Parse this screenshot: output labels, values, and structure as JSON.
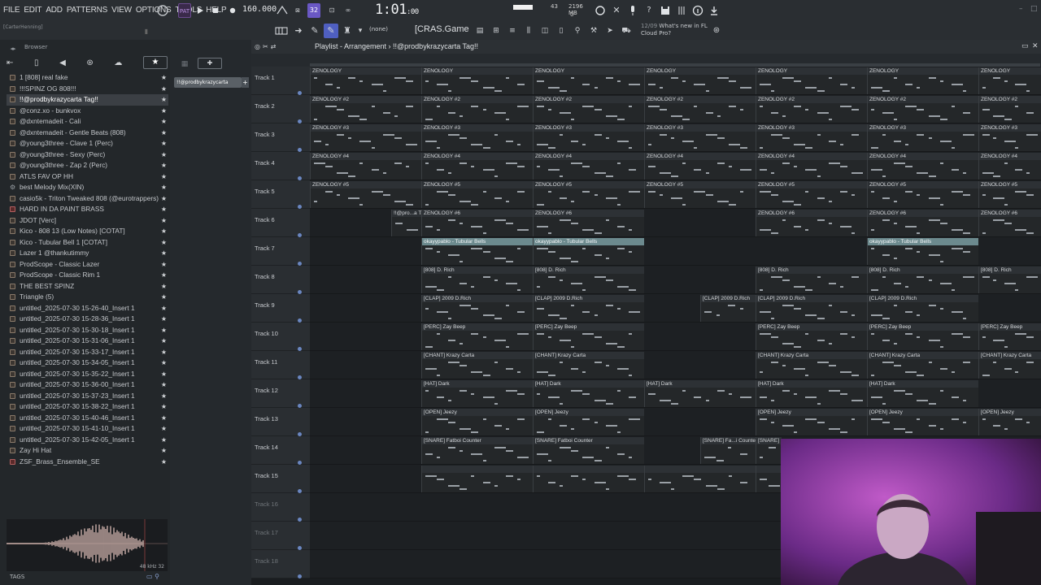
{
  "menu": [
    "FILE",
    "EDIT",
    "ADD",
    "PATTERNS",
    "VIEW",
    "OPTIONS",
    "TOOLS",
    "HELP"
  ],
  "toolbar": {
    "tempo": "160.000",
    "time_main": "1:01",
    "time_sub": ":00",
    "pattern_number": "32",
    "cpu_num": "43",
    "mem_mb": "2196 MB",
    "voices": "0",
    "pattern_select": "(none)",
    "song_name": "[CRAS.Game",
    "news_date": "12/09",
    "news_text_1": "What's new in FL",
    "news_text_2": "Cloud Pro?",
    "user": "[CarterHenning]"
  },
  "browser": {
    "title": "Browser",
    "items": [
      {
        "label": "1 [808] real fake",
        "icon": "folder"
      },
      {
        "label": "!!!SPINZ OG 808!!!",
        "icon": "folder"
      },
      {
        "label": "!!@prodbykrazycarta Tag!!",
        "icon": "folder",
        "selected": true
      },
      {
        "label": "@conz.xo - bunkvox",
        "icon": "folder"
      },
      {
        "label": "@dxntemadeit - Cali",
        "icon": "folder"
      },
      {
        "label": "@dxntemadeit - Gentle Beats (808)",
        "icon": "folder"
      },
      {
        "label": "@young3three - Clave 1 (Perc)",
        "icon": "folder"
      },
      {
        "label": "@young3three - Sexy (Perc)",
        "icon": "folder"
      },
      {
        "label": "@young3three - Zap 2 (Perc)",
        "icon": "folder"
      },
      {
        "label": "ATLS FAV OP HH",
        "icon": "folder"
      },
      {
        "label": "best Melody Mix(XIN)",
        "icon": "gear"
      },
      {
        "label": "casio5k - Triton Tweaked 808 (@eurotrappers)",
        "icon": "folder"
      },
      {
        "label": "HARD IN DA PAINT BRASS",
        "icon": "red"
      },
      {
        "label": "JDOT [Verc]",
        "icon": "folder"
      },
      {
        "label": "Kico - 808 13 (Low Notes) [COTAT]",
        "icon": "folder"
      },
      {
        "label": "Kico - Tubular Bell 1 [COTAT]",
        "icon": "folder"
      },
      {
        "label": "Lazer 1 @thankutimmy",
        "icon": "folder"
      },
      {
        "label": "ProdScope - Classic Lazer",
        "icon": "folder"
      },
      {
        "label": "ProdScope - Classic Rim 1",
        "icon": "folder"
      },
      {
        "label": "THE BEST SPINZ",
        "icon": "folder"
      },
      {
        "label": "Triangle (5)",
        "icon": "folder"
      },
      {
        "label": "untitled_2025-07-30 15-26-40_Insert 1",
        "icon": "folder"
      },
      {
        "label": "untitled_2025-07-30 15-28-36_Insert 1",
        "icon": "folder"
      },
      {
        "label": "untitled_2025-07-30 15-30-18_Insert 1",
        "icon": "folder"
      },
      {
        "label": "untitled_2025-07-30 15-31-06_Insert 1",
        "icon": "folder"
      },
      {
        "label": "untitled_2025-07-30 15-33-17_Insert 1",
        "icon": "folder"
      },
      {
        "label": "untitled_2025-07-30 15-34-05_Insert 1",
        "icon": "folder"
      },
      {
        "label": "untitled_2025-07-30 15-35-22_Insert 1",
        "icon": "folder"
      },
      {
        "label": "untitled_2025-07-30 15-36-00_Insert 1",
        "icon": "folder"
      },
      {
        "label": "untitled_2025-07-30 15-37-23_Insert 1",
        "icon": "folder"
      },
      {
        "label": "untitled_2025-07-30 15-38-22_Insert 1",
        "icon": "folder"
      },
      {
        "label": "untitled_2025-07-30 15-40-46_Insert 1",
        "icon": "folder"
      },
      {
        "label": "untitled_2025-07-30 15-41-10_Insert 1",
        "icon": "folder"
      },
      {
        "label": "untitled_2025-07-30 15-42-05_Insert 1",
        "icon": "folder"
      },
      {
        "label": "Zay Hi Hat",
        "icon": "folder"
      },
      {
        "label": "ZSF_Brass_Ensemble_SE",
        "icon": "red"
      }
    ],
    "preview_samplerate": "48 kHz 32",
    "tags_label": "TAGS"
  },
  "channel": {
    "selected_label": "!!@prodbykrazycarta"
  },
  "playlist": {
    "title": "Playlist - Arrangement  ›  !!@prodbykrazycarta Tag!!",
    "tracks": [
      {
        "name": "Track 1",
        "clips": [
          {
            "s": 0,
            "w": 137,
            "l": "ZENOLOGY"
          },
          {
            "s": 137,
            "w": 137,
            "l": "ZENOLOGY"
          },
          {
            "s": 274,
            "w": 137,
            "l": "ZENOLOGY"
          },
          {
            "s": 411,
            "w": 137,
            "l": "ZENOLOGY"
          },
          {
            "s": 548,
            "w": 137,
            "l": "ZENOLOGY"
          },
          {
            "s": 685,
            "w": 137,
            "l": "ZENOLOGY"
          },
          {
            "s": 822,
            "w": 77,
            "l": "ZENOLOGY"
          }
        ]
      },
      {
        "name": "Track 2",
        "clips": [
          {
            "s": 0,
            "w": 137,
            "l": "ZENOLOGY #2"
          },
          {
            "s": 137,
            "w": 137,
            "l": "ZENOLOGY #2"
          },
          {
            "s": 274,
            "w": 137,
            "l": "ZENOLOGY #2"
          },
          {
            "s": 411,
            "w": 137,
            "l": "ZENOLOGY #2"
          },
          {
            "s": 548,
            "w": 137,
            "l": "ZENOLOGY #2"
          },
          {
            "s": 685,
            "w": 137,
            "l": "ZENOLOGY #2"
          },
          {
            "s": 822,
            "w": 77,
            "l": "ZENOLOGY #2"
          }
        ]
      },
      {
        "name": "Track 3",
        "clips": [
          {
            "s": 0,
            "w": 137,
            "l": "ZENOLOGY #3"
          },
          {
            "s": 137,
            "w": 137,
            "l": "ZENOLOGY #3"
          },
          {
            "s": 274,
            "w": 137,
            "l": "ZENOLOGY #3"
          },
          {
            "s": 411,
            "w": 137,
            "l": "ZENOLOGY #3"
          },
          {
            "s": 548,
            "w": 137,
            "l": "ZENOLOGY #3"
          },
          {
            "s": 685,
            "w": 137,
            "l": "ZENOLOGY #3"
          },
          {
            "s": 822,
            "w": 77,
            "l": "ZENOLOGY #3"
          }
        ]
      },
      {
        "name": "Track 4",
        "clips": [
          {
            "s": 0,
            "w": 137,
            "l": "ZENOLOGY #4"
          },
          {
            "s": 137,
            "w": 137,
            "l": "ZENOLOGY #4"
          },
          {
            "s": 274,
            "w": 137,
            "l": "ZENOLOGY #4"
          },
          {
            "s": 411,
            "w": 137,
            "l": "ZENOLOGY #4"
          },
          {
            "s": 548,
            "w": 137,
            "l": "ZENOLOGY #4"
          },
          {
            "s": 685,
            "w": 137,
            "l": "ZENOLOGY #4"
          },
          {
            "s": 822,
            "w": 77,
            "l": "ZENOLOGY #4"
          }
        ]
      },
      {
        "name": "Track 5",
        "clips": [
          {
            "s": 0,
            "w": 137,
            "l": "ZENOLOGY #5"
          },
          {
            "s": 137,
            "w": 137,
            "l": "ZENOLOGY #5"
          },
          {
            "s": 274,
            "w": 137,
            "l": "ZENOLOGY #5"
          },
          {
            "s": 411,
            "w": 137,
            "l": "ZENOLOGY #5"
          },
          {
            "s": 548,
            "w": 137,
            "l": "ZENOLOGY #5"
          },
          {
            "s": 685,
            "w": 137,
            "l": "ZENOLOGY #5"
          },
          {
            "s": 822,
            "w": 77,
            "l": "ZENOLOGY #5"
          }
        ]
      },
      {
        "name": "Track 6",
        "clips": [
          {
            "s": 100,
            "w": 37,
            "l": "!!@pro...a Tag!!",
            "hl": false
          },
          {
            "s": 137,
            "w": 137,
            "l": "ZENOLOGY #6"
          },
          {
            "s": 274,
            "w": 137,
            "l": "ZENOLOGY #6"
          },
          {
            "s": 548,
            "w": 137,
            "l": "ZENOLOGY #6"
          },
          {
            "s": 685,
            "w": 137,
            "l": "ZENOLOGY #6"
          },
          {
            "s": 822,
            "w": 77,
            "l": "ZENOLOGY #6"
          }
        ]
      },
      {
        "name": "Track 7",
        "clips": [
          {
            "s": 137,
            "w": 137,
            "l": "okayypablo - Tubular Bells",
            "hl": true
          },
          {
            "s": 274,
            "w": 137,
            "l": "okayypablo - Tubular Bells",
            "hl": true
          },
          {
            "s": 685,
            "w": 137,
            "l": "okayypablo - Tubular Bells",
            "hl": true
          }
        ]
      },
      {
        "name": "Track 8",
        "clips": [
          {
            "s": 137,
            "w": 137,
            "l": "[808] D. Rich"
          },
          {
            "s": 274,
            "w": 137,
            "l": "[808] D. Rich"
          },
          {
            "s": 548,
            "w": 137,
            "l": "[808] D. Rich"
          },
          {
            "s": 685,
            "w": 137,
            "l": "[808] D. Rich"
          },
          {
            "s": 822,
            "w": 77,
            "l": "[808] D. Rich"
          }
        ]
      },
      {
        "name": "Track 9",
        "clips": [
          {
            "s": 137,
            "w": 137,
            "l": "[CLAP] 2009 D.Rich"
          },
          {
            "s": 274,
            "w": 137,
            "l": "[CLAP] 2009 D.Rich"
          },
          {
            "s": 480,
            "w": 68,
            "l": "[CLAP] 2009 D.Rich"
          },
          {
            "s": 548,
            "w": 137,
            "l": "[CLAP] 2009 D.Rich"
          },
          {
            "s": 685,
            "w": 137,
            "l": "[CLAP] 2009 D.Rich"
          }
        ]
      },
      {
        "name": "Track 10",
        "clips": [
          {
            "s": 137,
            "w": 137,
            "l": "[PERC] Zay Beep"
          },
          {
            "s": 274,
            "w": 137,
            "l": "[PERC] Zay Beep"
          },
          {
            "s": 548,
            "w": 137,
            "l": "[PERC] Zay Beep"
          },
          {
            "s": 685,
            "w": 137,
            "l": "[PERC] Zay Beep"
          },
          {
            "s": 822,
            "w": 77,
            "l": "[PERC] Zay Beep"
          }
        ]
      },
      {
        "name": "Track 11",
        "clips": [
          {
            "s": 137,
            "w": 137,
            "l": "[CHANT] Krazy Carta"
          },
          {
            "s": 274,
            "w": 137,
            "l": "[CHANT] Krazy Carta"
          },
          {
            "s": 548,
            "w": 137,
            "l": "[CHANT] Krazy Carta"
          },
          {
            "s": 685,
            "w": 137,
            "l": "[CHANT] Krazy Carta"
          },
          {
            "s": 822,
            "w": 77,
            "l": "[CHANT] Krazy Carta"
          }
        ]
      },
      {
        "name": "Track 12",
        "clips": [
          {
            "s": 137,
            "w": 137,
            "l": "[HAT] Dark"
          },
          {
            "s": 274,
            "w": 137,
            "l": "[HAT] Dark"
          },
          {
            "s": 411,
            "w": 137,
            "l": "[HAT] Dark"
          },
          {
            "s": 548,
            "w": 137,
            "l": "[HAT] Dark"
          },
          {
            "s": 685,
            "w": 137,
            "l": "[HAT] Dark"
          }
        ]
      },
      {
        "name": "Track 13",
        "clips": [
          {
            "s": 137,
            "w": 137,
            "l": "[OPEN] Jeezy"
          },
          {
            "s": 274,
            "w": 137,
            "l": "[OPEN] Jeezy"
          },
          {
            "s": 548,
            "w": 137,
            "l": "[OPEN] Jeezy"
          },
          {
            "s": 685,
            "w": 137,
            "l": "[OPEN] Jeezy"
          },
          {
            "s": 822,
            "w": 77,
            "l": "[OPEN] Jeezy"
          }
        ]
      },
      {
        "name": "Track 14",
        "clips": [
          {
            "s": 137,
            "w": 137,
            "l": "[SNARE] Fatboi Counter"
          },
          {
            "s": 274,
            "w": 137,
            "l": "[SNARE] Fatboi Counter"
          },
          {
            "s": 480,
            "w": 68,
            "l": "[SNARE] Fa...i Counter"
          },
          {
            "s": 548,
            "w": 32,
            "l": "[SNARE]"
          }
        ]
      },
      {
        "name": "Track 15",
        "clips": [
          {
            "s": 137,
            "w": 137,
            "l": ""
          },
          {
            "s": 274,
            "w": 137,
            "l": ""
          },
          {
            "s": 411,
            "w": 137,
            "l": ""
          },
          {
            "s": 548,
            "w": 32,
            "l": ""
          }
        ]
      },
      {
        "name": "Track 16",
        "clips": [],
        "dim": true
      },
      {
        "name": "Track 17",
        "clips": [],
        "dim": true
      },
      {
        "name": "Track 18",
        "clips": [],
        "dim": true
      }
    ]
  }
}
